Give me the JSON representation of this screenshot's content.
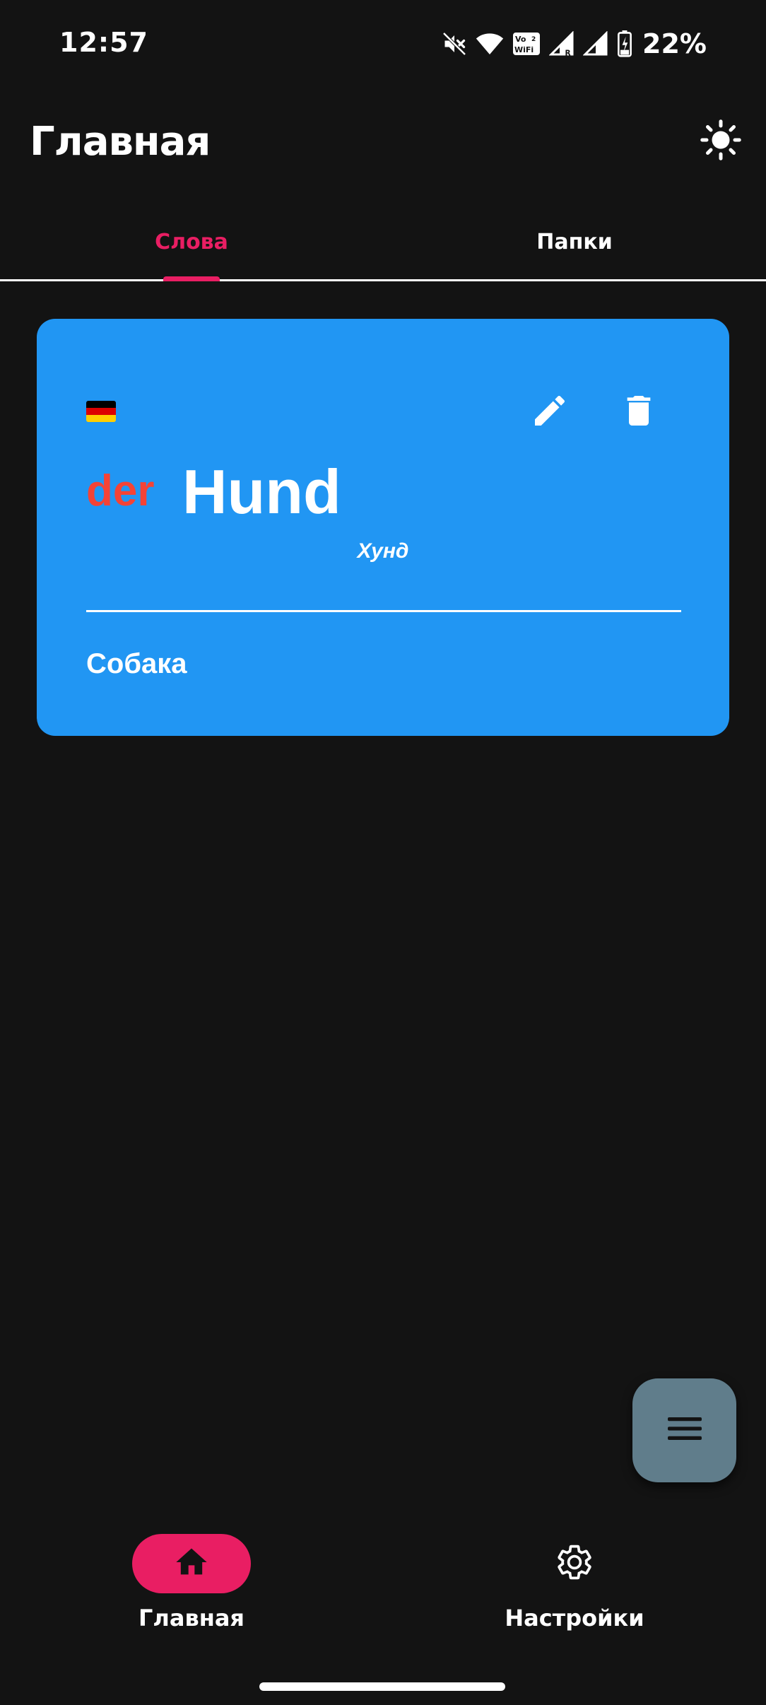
{
  "status_bar": {
    "time": "12:57",
    "battery_percent": "22%",
    "icons": [
      "mute-icon",
      "wifi-icon",
      "vowifi-icon",
      "signal-roaming-icon",
      "signal-icon",
      "battery-charging-icon"
    ],
    "vowifi_label": "Vo WiFi"
  },
  "app_bar": {
    "title": "Главная",
    "theme_icon": "sun-icon"
  },
  "tabs": [
    {
      "label": "Слова",
      "selected": true
    },
    {
      "label": "Папки",
      "selected": false
    }
  ],
  "word_card": {
    "flag": "germany-flag",
    "article": "der",
    "word": "Hund",
    "transcription": "Хунд",
    "translation": "Собака",
    "background_color": "#2196f3",
    "article_color": "#f44336",
    "edit_icon": "pencil-icon",
    "delete_icon": "trash-icon"
  },
  "fab": {
    "icon": "menu-icon",
    "color": "#607d8b"
  },
  "bottom_nav": {
    "items": [
      {
        "label": "Главная",
        "icon": "home-icon",
        "selected": true
      },
      {
        "label": "Настройки",
        "icon": "gear-icon",
        "selected": false
      }
    ],
    "accent_color": "#e91e63"
  }
}
